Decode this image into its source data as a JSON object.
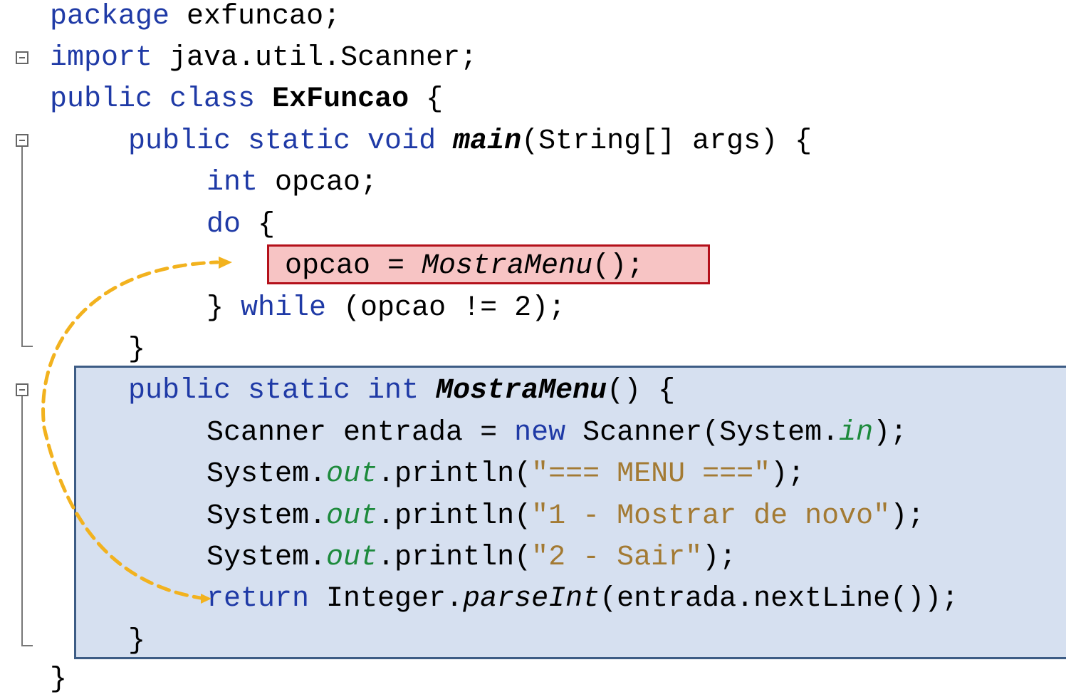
{
  "editor": {
    "lines": {
      "package": {
        "kw": "package",
        "rest": " exfuncao;"
      },
      "import": {
        "kw": "import",
        "rest": " java.util.Scanner;"
      },
      "class_decl": {
        "kw": "public class",
        "name": "ExFuncao",
        "rest": " {"
      },
      "main_decl": {
        "kw": "public static void",
        "name": "main",
        "rest": "(String[] args) {"
      },
      "int_decl": {
        "kw": "int",
        "rest": " opcao;"
      },
      "do": {
        "kw": "do",
        "rest": " {"
      },
      "assign": {
        "text": "opcao = ",
        "call": "MostraMenu",
        "rest": "();"
      },
      "while": {
        "pre": "} ",
        "kw": "while",
        "rest": " (opcao != 2);"
      },
      "close_main": "}",
      "menu_decl": {
        "kw": "public static int",
        "name": "MostraMenu",
        "rest": "() {"
      },
      "scanner": {
        "pre": "Scanner entrada = ",
        "kw": "new",
        "mid": " Scanner(System.",
        "field": "in",
        "rest": ");"
      },
      "println1": {
        "pre": "System.",
        "field": "out",
        "mid": ".println(",
        "str": "\"=== MENU ===\"",
        "rest": ");"
      },
      "println2": {
        "pre": "System.",
        "field": "out",
        "mid": ".println(",
        "str": "\"1 - Mostrar de novo\"",
        "rest": ");"
      },
      "println3": {
        "pre": "System.",
        "field": "out",
        "mid": ".println(",
        "str": "\"2 - Sair\"",
        "rest": ");"
      },
      "return": {
        "kw": "return",
        "mid": " Integer.",
        "method": "parseInt",
        "rest": "(entrada.nextLine());"
      },
      "close_menu": "}",
      "close_class": "}"
    }
  },
  "colors": {
    "keyword": "#1f3aa6",
    "field": "#1d8a3c",
    "string": "#a37a33",
    "highlight_call_fill": "#f7c4c4",
    "highlight_call_border": "#b4101a",
    "highlight_method_fill": "#d6e0f0",
    "highlight_method_border": "#3d5c85",
    "arrow": "#f2b21e"
  }
}
